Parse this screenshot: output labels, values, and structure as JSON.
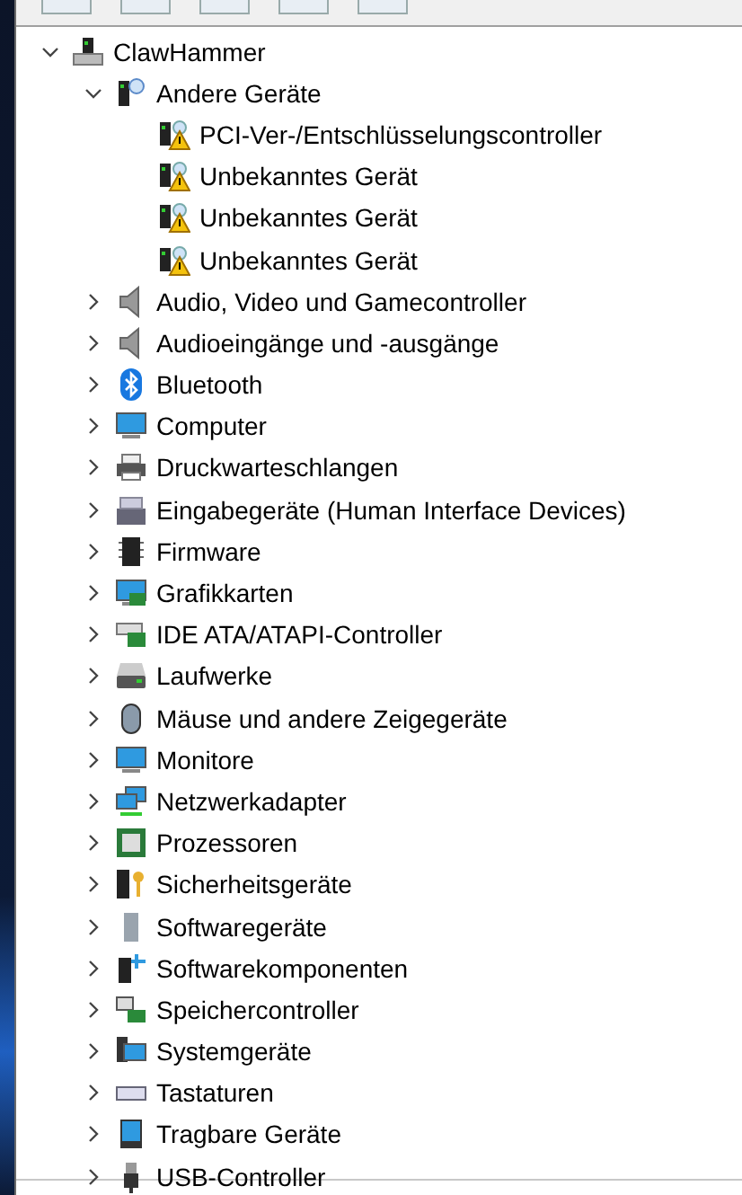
{
  "tree": {
    "label": "ClawHammer",
    "expanded": true,
    "children": [
      {
        "label": "Andere Geräte",
        "expanded": true,
        "children": [
          {
            "label": "PCI-Ver-/Entschlüsselungscontroller"
          },
          {
            "label": "Unbekanntes Gerät"
          },
          {
            "label": "Unbekanntes Gerät"
          },
          {
            "label": "Unbekanntes Gerät"
          }
        ]
      },
      {
        "label": "Audio, Video und Gamecontroller",
        "expanded": false
      },
      {
        "label": "Audioeingänge und -ausgänge",
        "expanded": false
      },
      {
        "label": "Bluetooth",
        "expanded": false
      },
      {
        "label": "Computer",
        "expanded": false
      },
      {
        "label": "Druckwarteschlangen",
        "expanded": false
      },
      {
        "label": "Eingabegeräte (Human Interface Devices)",
        "expanded": false
      },
      {
        "label": "Firmware",
        "expanded": false
      },
      {
        "label": "Grafikkarten",
        "expanded": false
      },
      {
        "label": "IDE ATA/ATAPI-Controller",
        "expanded": false
      },
      {
        "label": "Laufwerke",
        "expanded": false
      },
      {
        "label": "Mäuse und andere Zeigegeräte",
        "expanded": false
      },
      {
        "label": "Monitore",
        "expanded": false
      },
      {
        "label": "Netzwerkadapter",
        "expanded": false
      },
      {
        "label": "Prozessoren",
        "expanded": false
      },
      {
        "label": "Sicherheitsgeräte",
        "expanded": false
      },
      {
        "label": "Softwaregeräte",
        "expanded": false
      },
      {
        "label": "Softwarekomponenten",
        "expanded": false
      },
      {
        "label": "Speichercontroller",
        "expanded": false
      },
      {
        "label": "Systemgeräte",
        "expanded": false
      },
      {
        "label": "Tastaturen",
        "expanded": false
      },
      {
        "label": "Tragbare Geräte",
        "expanded": false
      },
      {
        "label": "USB-Controller",
        "expanded": false
      }
    ]
  }
}
